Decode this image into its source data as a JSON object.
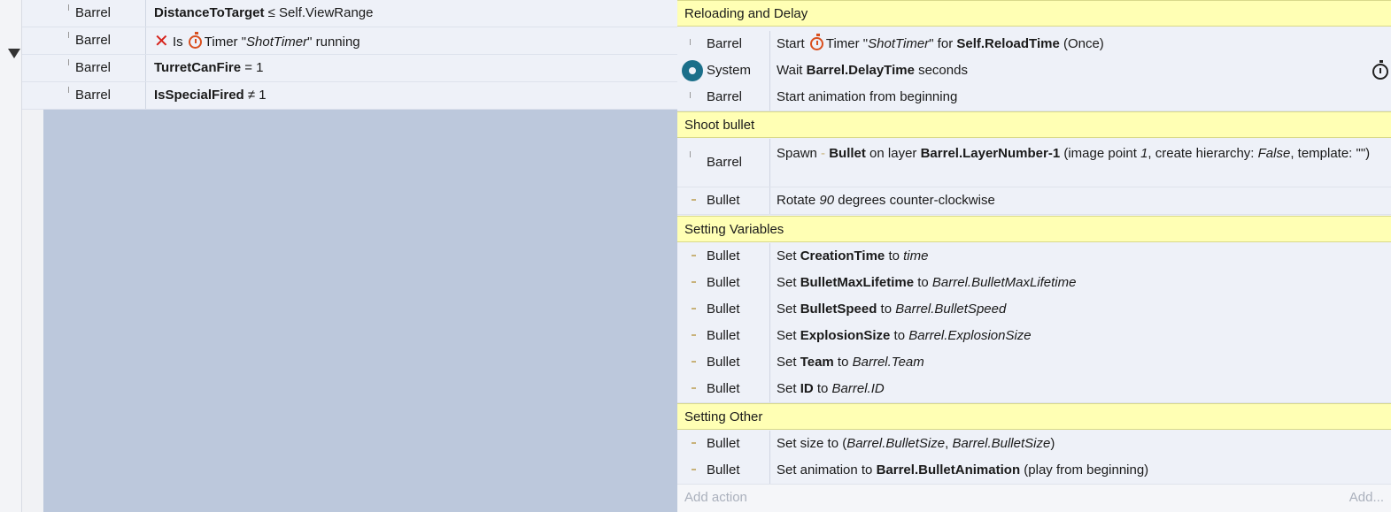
{
  "conditions": [
    {
      "object": "Barrel",
      "parts": {
        "bold": "DistanceToTarget",
        "rest": " ≤ Self.ViewRange"
      }
    },
    {
      "object": "Barrel",
      "parts": {
        "prefix": "Is",
        "timer_label": "Timer \"",
        "timer_name": "ShotTimer",
        "suffix": "\" running"
      }
    },
    {
      "object": "Barrel",
      "parts": {
        "bold": "TurretCanFire",
        "rest": " = 1"
      }
    },
    {
      "object": "Barrel",
      "parts": {
        "bold": "IsSpecialFired",
        "rest": " ≠ 1"
      }
    }
  ],
  "groups": {
    "reloading": "Reloading and Delay",
    "shoot": "Shoot bullet",
    "variables": "Setting Variables",
    "other": "Setting Other"
  },
  "actions": {
    "start_timer": {
      "object": "Barrel",
      "a": "Start ",
      "b": "Timer \"",
      "c": "ShotTimer",
      "d": "\" for ",
      "e": "Self.ReloadTime",
      "f": " (Once)"
    },
    "wait": {
      "object": "System",
      "a": "Wait ",
      "b": "Barrel.DelayTime",
      "c": " seconds"
    },
    "anim_start": {
      "object": "Barrel",
      "a": "Start animation from beginning"
    },
    "spawn": {
      "object": "Barrel",
      "a": "Spawn ",
      "b": "Bullet",
      "c": " on layer ",
      "d": "Barrel.LayerNumber-1",
      "e": " (image point ",
      "f": "1",
      "g": ", create hierarchy: ",
      "h": "False",
      "i": ", template: \"\")"
    },
    "rotate": {
      "object": "Bullet",
      "a": "Rotate ",
      "b": "90",
      "c": " degrees counter-clockwise"
    },
    "vars": [
      {
        "object": "Bullet",
        "name": "CreationTime",
        "value": "time"
      },
      {
        "object": "Bullet",
        "name": "BulletMaxLifetime",
        "value": "Barrel.BulletMaxLifetime"
      },
      {
        "object": "Bullet",
        "name": "BulletSpeed",
        "value": "Barrel.BulletSpeed"
      },
      {
        "object": "Bullet",
        "name": "ExplosionSize",
        "value": "Barrel.ExplosionSize"
      },
      {
        "object": "Bullet",
        "name": "Team",
        "value": "Barrel.Team"
      },
      {
        "object": "Bullet",
        "name": "ID",
        "value": "Barrel.ID"
      }
    ],
    "set_word": "Set ",
    "to_word": " to ",
    "size": {
      "object": "Bullet",
      "a": "Set size to (",
      "b": "Barrel.BulletSize",
      "c": ", ",
      "d": "Barrel.BulletSize",
      "e": ")"
    },
    "anim_set": {
      "object": "Bullet",
      "a": "Set animation to ",
      "b": "Barrel.BulletAnimation",
      "c": " (play from beginning)"
    }
  },
  "footer": {
    "add_action": "Add action",
    "add_more": "Add..."
  },
  "icons": {
    "timer": "timer-icon",
    "system": "gear-icon",
    "stopwatch": "stopwatch-icon",
    "invert": "close-icon"
  },
  "colors": {
    "group_bg": "#ffffb4",
    "row_bg": "#eef1f8",
    "blank_bg": "#bcc8dc",
    "timer": "#d94f1e",
    "invert_x": "#d6221b"
  }
}
